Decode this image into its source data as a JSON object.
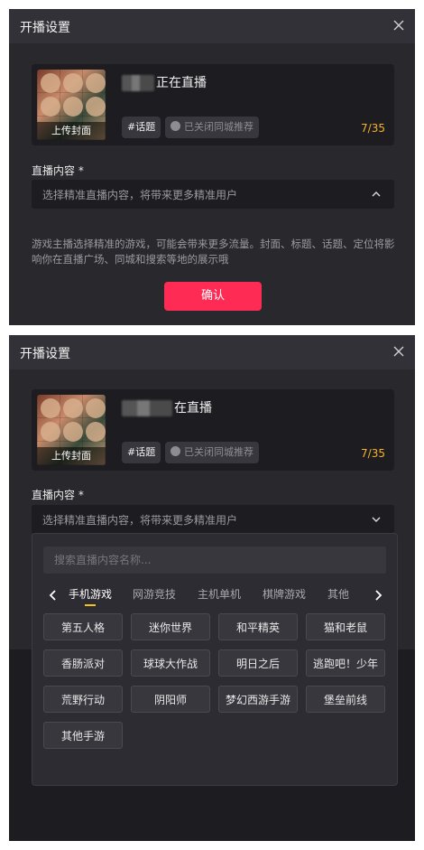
{
  "dialog": {
    "title": "开播设置",
    "upload_cover_label": "上传封面",
    "stream_title_suffix_1": "正在直播",
    "stream_title_suffix_2": "在直播",
    "topic_chip": "#话题",
    "city_recommend_chip": "已关闭同城推荐",
    "title_counter": "7/35",
    "content_label": "直播内容 *",
    "content_placeholder": "选择精准直播内容，将带来更多精准用户",
    "description": "游戏主播选择精准的游戏，可能会带来更多流量。封面、标题、话题、定位将影响你在直播广场、同城和搜索等地的展示哦",
    "confirm_label": "确认"
  },
  "dropdown": {
    "search_placeholder": "搜索直播内容名称...",
    "tabs": [
      {
        "label": "手机游戏",
        "active": true
      },
      {
        "label": "网游竞技",
        "active": false
      },
      {
        "label": "主机单机",
        "active": false
      },
      {
        "label": "棋牌游戏",
        "active": false
      },
      {
        "label": "其他",
        "active": false
      }
    ],
    "games": [
      "第五人格",
      "迷你世界",
      "和平精英",
      "猫和老鼠",
      "香肠派对",
      "球球大作战",
      "明日之后",
      "逃跑吧！少年",
      "荒野行动",
      "阴阳师",
      "梦幻西游手游",
      "堡垒前线",
      "其他手游"
    ]
  },
  "colors": {
    "accent": "#fe2c55",
    "counter": "#f7b32b",
    "tab_underline": "#f7c21b",
    "panel_bg": "#29282d",
    "header_bg": "#323137"
  },
  "icons": {
    "close": "close-icon",
    "chevron_up": "chevron-up-icon",
    "chevron_down": "chevron-down-icon",
    "arrow_left": "arrow-left-icon",
    "arrow_right": "arrow-right-icon"
  }
}
